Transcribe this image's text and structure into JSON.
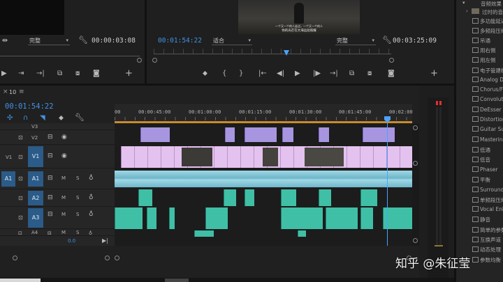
{
  "source_monitor": {
    "timecode": "00:00:03:08",
    "fit_dropdown": "完整"
  },
  "program_monitor": {
    "subtitle_line1": "一个又一个的人走过，一个又一个的人",
    "subtitle_line2": "你的光芒在大海远处照耀",
    "playhead_timecode": "00:01:54:22",
    "zoom_dropdown": "适合",
    "quality_dropdown": "完整",
    "duration_timecode": "00:03:25:09"
  },
  "timeline": {
    "close_glyph": "×",
    "sequence_name": "10",
    "menu_glyph": "≡",
    "playhead_timecode": "00:01:54:22",
    "ruler_labels": [
      "00",
      "00:00:45:00",
      "00:01:00:00",
      "00:01:15:00",
      "00:01:30:00",
      "00:01:45:00",
      "00:02:00"
    ],
    "tracks": {
      "v3": "V3",
      "v2": "V2",
      "v1_source": "V1",
      "v1": "V1",
      "a1_source": "A1",
      "a1": "A1",
      "a2": "A2",
      "a3": "A3",
      "a4": "A4",
      "mute": "M",
      "solo": "S",
      "volume_value": "0.0"
    }
  },
  "effects_panel": {
    "folder_label": "过时的音频",
    "items": [
      "音频效果",
      "多功能延迟",
      "多频段压缩器",
      "吊通",
      "用右侧",
      "用左侧",
      "电子管建模",
      "Analog Delay",
      "Chorus/Flanger",
      "Convolution",
      "DeEsser",
      "Distortion",
      "Guitar Suite",
      "Mastering",
      "低通",
      "低音",
      "Phaser",
      "平衡",
      "Surround Reverb",
      "单频段压缩器",
      "Vocal Enhancer",
      "静音",
      "简单的参数均衡",
      "互换声道",
      "动态处理",
      "参数均衡"
    ]
  },
  "watermark": "知乎 @朱征莹",
  "colors": {
    "timecode_blue": "#3f92e6",
    "video_clip": "#e4c2ef",
    "v2_clip": "#a895e0",
    "audio_clip": "#3fbfa6",
    "track_target": "#2b5b88",
    "playhead": "#4aa3ff",
    "meter_peak": "#e03030"
  }
}
